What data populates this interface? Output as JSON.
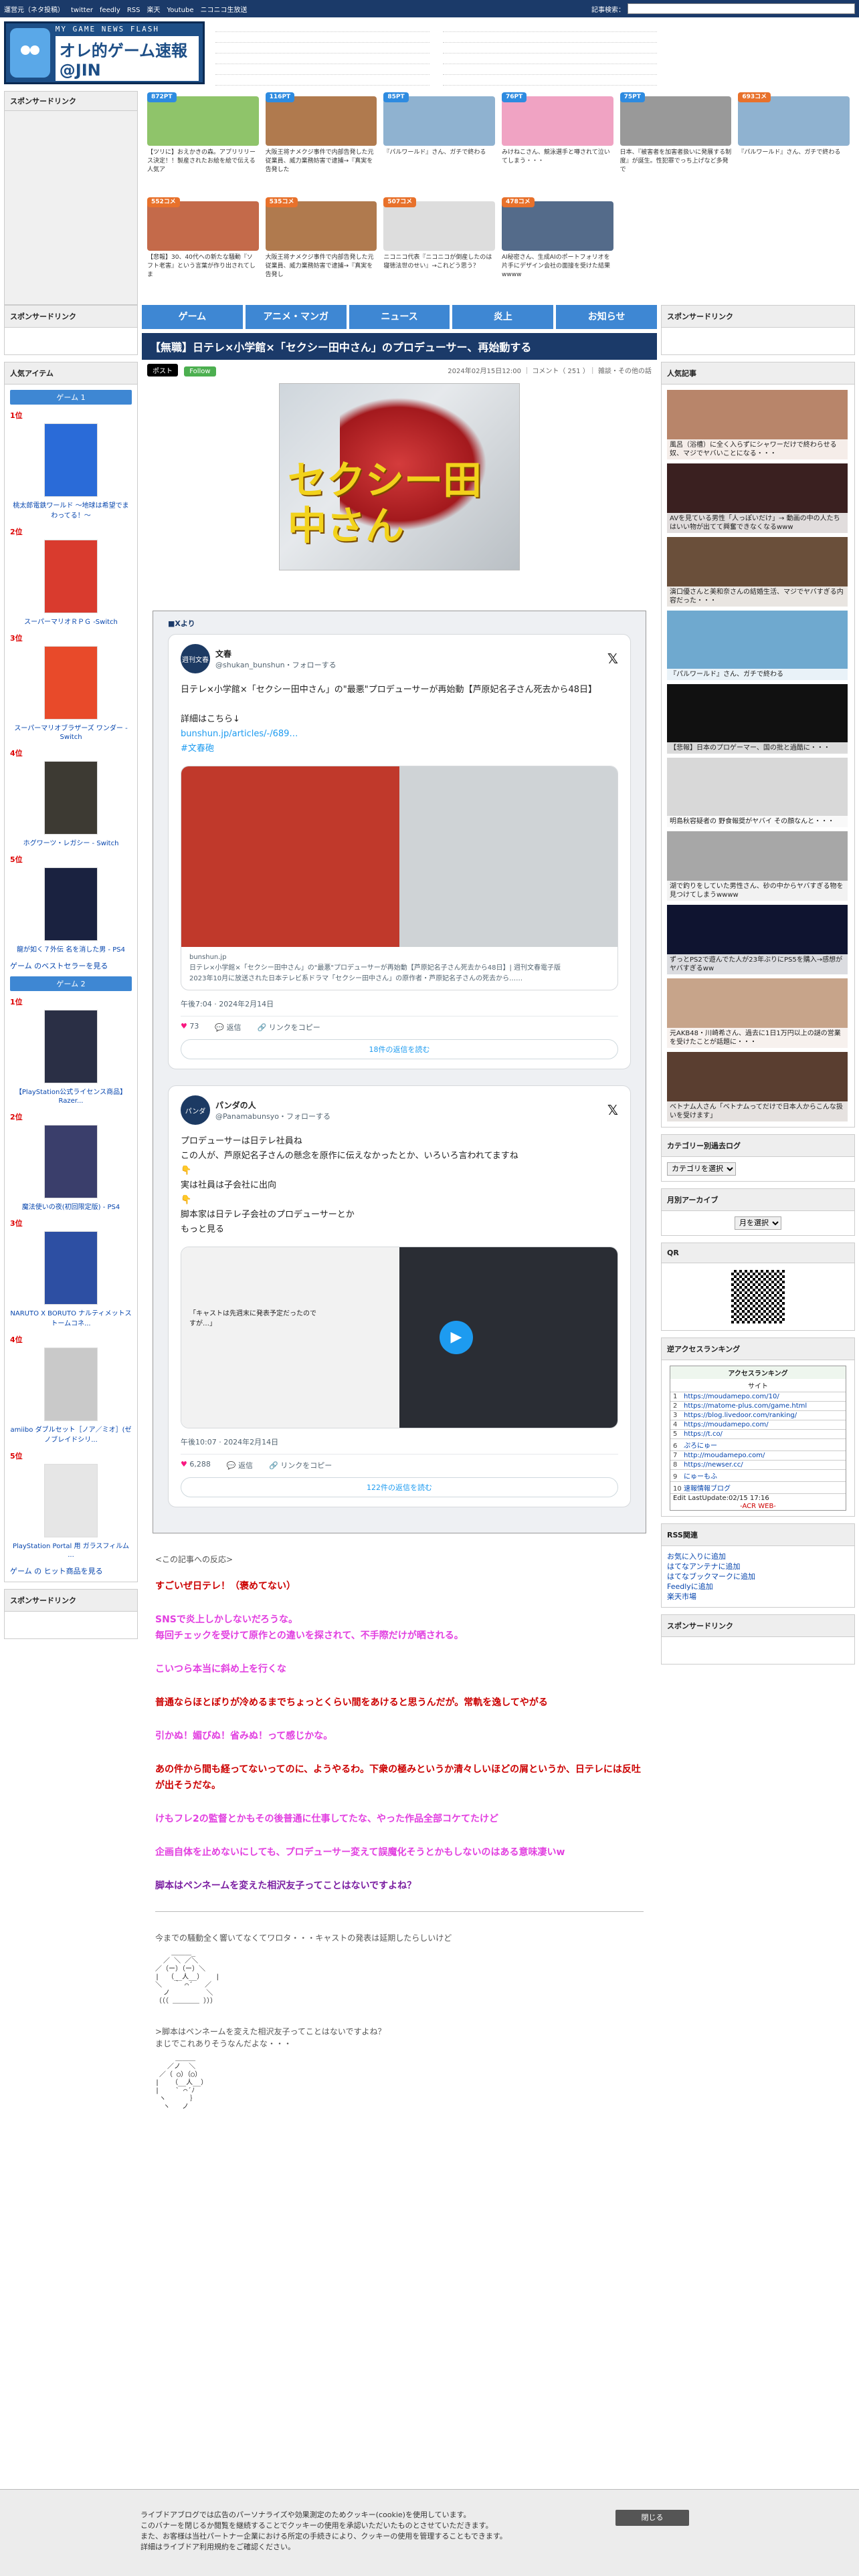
{
  "topbar": {
    "links": [
      "運営元（ネタ投稿）",
      "twitter",
      "feedly",
      "RSS",
      "楽天",
      "Youtube",
      "ニコニコ生放送"
    ],
    "search_label": "記事検索：",
    "search_value": ""
  },
  "logo": {
    "tagline": "MY GAME NEWS FLASH",
    "name": "オレ的ゲーム速報@JIN"
  },
  "sponsored_label": "スポンサードリンク",
  "ad_cards": [
    {
      "badge": "872PT",
      "badge_color": "#2e8be0",
      "text": "【ツリに】おえかきの森。アプリリリース決定！！製産されたお絵を絵で伝える人気ア"
    },
    {
      "badge": "116PT",
      "badge_color": "#2e8be0",
      "text": "大阪王将ナメクジ事件で内部告発した元従業員、威力業務妨害で逮捕→『真実を告発した"
    },
    {
      "badge": "85PT",
      "badge_color": "#2e8be0",
      "text": "『パルワールド』さん、ガチで終わる"
    },
    {
      "badge": "76PT",
      "badge_color": "#2e8be0",
      "text": "みけねこさん、競泳選手と噂されて泣いてしまう・・・"
    },
    {
      "badge": "75PT",
      "badge_color": "#2e8be0",
      "text": "日本、『被害者を加害者扱いに発展する制度』が誕生。性犯罪でっち上げなど多発で"
    },
    {
      "badge": "693コメ",
      "badge_color": "#e8712b",
      "text": "『パルワールド』さん、ガチで終わる"
    },
    {
      "badge": "552コメ",
      "badge_color": "#e8712b",
      "text": "【悲報】30、40代への新たな騒動『ソフト老害』という言葉が作り出されてしま"
    },
    {
      "badge": "535コメ",
      "badge_color": "#e8712b",
      "text": "大阪王将ナメクジ事件で内部告発した元従業員、威力業務妨害で逮捕→『真実を告発し"
    },
    {
      "badge": "507コメ",
      "badge_color": "#e8712b",
      "text": "ニコニコ代表『ニコニコが倒産したのは寝徳法世のせい』→これどう思う？"
    },
    {
      "badge": "478コメ",
      "badge_color": "#e8712b",
      "text": "AI秘密さん、生成AIのポートフォリオを片手にデザイン会社の面接を受けた結果wwww"
    }
  ],
  "nav": [
    "ゲーム",
    "アニメ・マンガ",
    "ニュース",
    "炎上",
    "お知らせ"
  ],
  "article": {
    "title": "【無職】日テレ×小学館×「セクシー田中さん」のプロデューサー、再始動する",
    "tweet_btn": "ポスト",
    "follow_btn": "Follow",
    "meta": "2024年02月15日12:00 ｜ コメント（ 251 ）｜ 雑談・その他の話",
    "hero_text": "セクシー田中さん",
    "embed_label": "■Xより"
  },
  "tweets": [
    {
      "avatar": "週刊文春",
      "name": "文春",
      "handle": "@shukan_bunshun・フォローする",
      "body": "日テレ×小学館×「セクシー田中さん」の\"最悪\"プロデューサーが再始動【芦原妃名子さん死去から48日】\n\n詳細はこちら↓",
      "link": "bunshun.jp/articles/-/689…",
      "tag": "#文春砲",
      "card_domain": "bunshun.jp",
      "card_text": "日テレ×小学館×「セクシー田中さん」の\"最悪\"プロデューサーが再始動【芦原妃名子さん死去から48日】| 週刊文春電子版\n2023年10月に放送された日本テレビ系ドラマ「セクシー田中さん」の原作者・芦原妃名子さんの死去から……",
      "time": "午後7:04 · 2024年2月14日",
      "likes": "73",
      "replies": "返信",
      "share": "リンクをコピー",
      "more": "18件の返信を読む"
    },
    {
      "avatar": "パンダ",
      "name": "パンダの人",
      "handle": "@Panamabunsyo・フォローする",
      "body": "プロデューサーは日テレ社員ね\nこの人が、芦原妃名子さんの懸念を原作に伝えなかったとか、いろいろ言われてますね\n👇\n実は社員は子会社に出向\n👇\n脚本家は日テレ子会社のプロデューサーとか\nもっと見る",
      "link": "もっと見る",
      "tag": "",
      "card_domain": "",
      "card_text": "「キャストは先週末に発表予定だったのですが…」",
      "time": "午後10:07 · 2024年2月14日",
      "likes": "6,288",
      "replies": "返信",
      "share": "リンクをコピー",
      "more": "122件の返信を読む"
    }
  ],
  "card2_caption": "「キャストは先週末に発表予定だったのですが…」",
  "source_link": "<この記事への反応>",
  "comments": [
    {
      "text": "すごいぜ日テレ！（褒めてない）",
      "color": "#c00"
    },
    {
      "text": "SNSで炎上しかしないだろうな。\n毎回チェックを受けて原作との違いを探されて、不手際だけが晒される。",
      "color": "#e23fe0"
    },
    {
      "text": "こいつら本当に斜め上を行くな",
      "color": "#e23fe0"
    },
    {
      "text": "普通ならほとぼりが冷めるまでちょっとくらい間をあけると思うんだが。常軌を逸してやがる",
      "color": "#c00"
    },
    {
      "text": "引かぬ！媚びぬ！省みぬ！って感じかな。",
      "color": "#e23fe0"
    },
    {
      "text": "あの件から間も経ってないってのに、ようやるわ。下衆の極みというか清々しいほどの屑というか、日テレには反吐が出そうだな。",
      "color": "#c00"
    },
    {
      "text": "けもフレ2の監督とかもその後普通に仕事してたな、やった作品全部コケてたけど",
      "color": "#e23fe0"
    },
    {
      "text": "企画自体を止めないにしても、プロデューサー変えて誤魔化そうとかもしないのはある意味凄いw",
      "color": "#e23fe0"
    },
    {
      "text": "脚本はペンネームを変えた相沢友子ってことはないですよね？",
      "color": "#7b1fa2"
    }
  ],
  "aa_blocks": [
    {
      "lead": "今までの騒動全く響いてなくてワロタ・・・キャストの発表は延期したらしいけど",
      "art": "    ＿＿＿_\n  ／ ＼ ／＼\n／（ー）（ー）＼\n|  （__人__）   |\n＼   ｀ ⌒´   ／\n  ノ         ＼\n（（（ ＿＿＿＿ ）））"
    },
    {
      "lead": ">脚本はペンネームを変えた相沢友子ってことはないですよね？\nまじでこれありそうなんだよな・・・",
      "art": "     ＿＿＿\n   ／ノ  ＼\n ／（ ○）（○）\n|   （__人__）\n|    ` ⌒´ﾉ\n ヽ      ｝\n  ヽ   ノ"
    }
  ],
  "left_sidebar": {
    "items_title": "人気アイテム",
    "rankings": [
      {
        "category": "ゲーム 1",
        "more": "ゲーム のベストセラーを見る",
        "items": [
          {
            "rank": "1位",
            "title": "桃太郎電鉄ワールド ～地球は希望でまわってる！～",
            "color": "#2a6bd8"
          },
          {
            "rank": "2位",
            "title": "スーパーマリオＲＰＧ -Switch",
            "color": "#d93b2e"
          },
          {
            "rank": "3位",
            "title": "スーパーマリオブラザーズ ワンダー -Switch",
            "color": "#e84a2a"
          },
          {
            "rank": "4位",
            "title": "ホグワーツ・レガシー - Switch",
            "color": "#3d3a33"
          },
          {
            "rank": "5位",
            "title": "龍が如く７外伝 名を消した男 - PS4",
            "color": "#1a2240"
          }
        ]
      },
      {
        "category": "ゲーム 2",
        "more": "ゲーム の ヒット商品を見る",
        "items": [
          {
            "rank": "1位",
            "title": "【PlayStation公式ライセンス商品】Razer...",
            "color": "#2a2f45"
          },
          {
            "rank": "2位",
            "title": "魔法使いの夜(初回限定版) - PS4",
            "color": "#3a3e6b"
          },
          {
            "rank": "3位",
            "title": "NARUTO X BORUTO ナルティメットストームコネ...",
            "color": "#2d4fa3"
          },
          {
            "rank": "4位",
            "title": "amiibo ダブルセット［ノア／ミオ］(ゼノブレイドシリ...",
            "color": "#c9c9c9"
          },
          {
            "rank": "5位",
            "title": "PlayStation Portal 用 ガラスフィルム ...",
            "color": "#e6e6e6"
          }
        ]
      }
    ]
  },
  "right_sidebar": {
    "popular_title": "人気記事",
    "popular": [
      {
        "caption": "風呂（浴槽）に全く入らずにシャワーだけで終わらせる奴、マジでヤバいことになる・・・",
        "color": "#b8856a"
      },
      {
        "caption": "AVを見ている男性「人っぽいだけ」→ 動画の中の人たちはいい物が出てて興奮できなくなるwww",
        "color": "#3a2020"
      },
      {
        "caption": "演口優さんと美和奈さんの結婚生活、マジでヤバすぎる内容だった・・・",
        "color": "#6a4f3a"
      },
      {
        "caption": "『パルワールド』さん、ガチで終わる",
        "color": "#6fa9cf"
      },
      {
        "caption": "【悲報】日本のプロゲーマー、国の批と過酷に・・・",
        "color": "#111"
      },
      {
        "caption": "明島秋容疑者の 野食報奨がヤバイ その顔なんと・・・",
        "color": "#d8d8d8"
      },
      {
        "caption": "湖で釣りをしていた男性さん、砂の中からヤバすぎる物を見つけてしまうwwww",
        "color": "#a7a7a7"
      },
      {
        "caption": "ずっとPS2で遊んでた人が23年ぶりにPS5を購入→感想がヤバすぎるww",
        "color": "#0f1430"
      },
      {
        "caption": "元AKB48・川崎希さん、過去に1日1万円以上の謎の営業を受けたことが話題に・・・",
        "color": "#c7a48a"
      },
      {
        "caption": "ベトナム人さん「ベトナムってだけで日本人からこんな扱いを受けます」",
        "color": "#5a3e30"
      }
    ],
    "cat_title": "カテゴリー別過去ログ",
    "cat_select": "カテゴリを選択",
    "month_title": "月別アーカイブ",
    "month_select": "月を選択",
    "qr_title": "QR",
    "access_title": "逆アクセスランキング",
    "access_head": "アクセスランキング",
    "access_sub": "サイト",
    "access_items": [
      "https://moudamepo.com/10/",
      "https://matome-plus.com/game.html",
      "https://blog.livedoor.com/ranking/",
      "https://moudamepo.com/",
      "https://t.co/",
      "ぷろにゅー",
      "http://moudamepo.com/",
      "https://newser.cc/",
      "にゅーもふ",
      "速報情報ブログ"
    ],
    "access_foot": "Edit LastUpdate:02/15 17:16",
    "access_brand": "-ACR WEB-",
    "rss_title": "RSS関連",
    "rss_links": [
      "お気に入りに追加",
      "はてなアンテナに追加",
      "はてなブックマークに追加",
      "Feedlyに追加",
      "楽天市場"
    ]
  },
  "cookie": {
    "text": "ライブドアブログでは広告のパーソナライズや効果測定のためクッキー(cookie)を使用しています。\nこのバナーを閉じるか閲覧を継続することでクッキーの使用を承認いただいたものとさせていただきます。\nまた、お客様は当社パートナー企業における所定の手続きにより、クッキーの使用を管理することもできます。\n詳細はライブドア利用規約をご確認ください。",
    "close": "閉じる"
  }
}
